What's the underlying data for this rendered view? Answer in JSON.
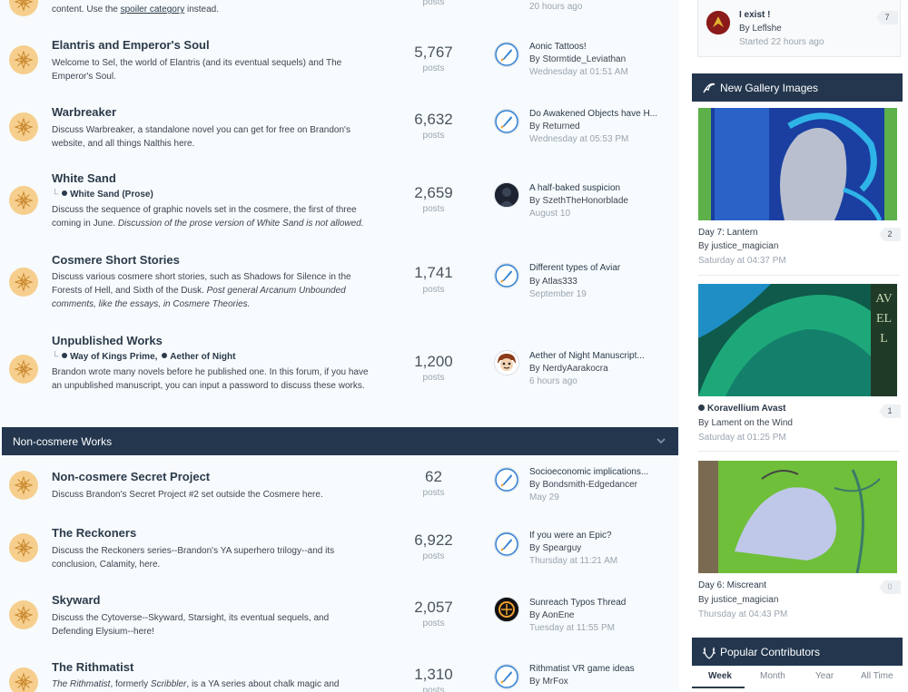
{
  "top_fragment": {
    "desc_prefix": "content. Use the ",
    "desc_link": "spoiler category",
    "desc_suffix": " instead.",
    "count_label": "posts",
    "last_time": "20 hours ago"
  },
  "forums": [
    {
      "title": "Elantris and Emperor's Soul",
      "description": "Welcome to Sel, the world of Elantris (and its eventual sequels) and The Emperor's Soul.",
      "count": "5,767",
      "count_label": "posts",
      "last_title": "Aonic Tattoos!",
      "last_by": "By Stormtide_Leviathan",
      "last_time": "Wednesday at 01:51 AM",
      "avatar": "quill-avatar"
    },
    {
      "title": "Warbreaker",
      "description": "Discuss Warbreaker, a standalone novel you can get for free on Brandon's website, and all things Nalthis here.",
      "count": "6,632",
      "count_label": "posts",
      "last_title": "Do Awakened Objects have H...",
      "last_by": "By Returned",
      "last_time": "Wednesday at 05:53 PM",
      "avatar": "quill-avatar"
    },
    {
      "title": "White Sand",
      "subforum": "White Sand (Prose)",
      "description": "Discuss the sequence of graphic novels set in the cosmere, the first of three coming in June.",
      "description_italic": "Discussion of the prose version of White Sand is not allowed.",
      "count": "2,659",
      "count_label": "posts",
      "last_title": "A half-baked suspicion",
      "last_by": "By SzethTheHonorblade",
      "last_time": "August 10",
      "avatar": "dark-figure-avatar"
    },
    {
      "title": "Cosmere Short Stories",
      "description": "Discuss various cosmere short stories, such as Shadows for Silence in the Forests of Hell, and Sixth of the Dusk.",
      "description_italic": "Post general Arcanum Unbounded comments, like the essays, in Cosmere Theories.",
      "count": "1,741",
      "count_label": "posts",
      "last_title": "Different types of Aviar",
      "last_by": "By Atlas333",
      "last_time": "September 19",
      "avatar": "quill-avatar"
    },
    {
      "title": "Unpublished Works",
      "subforum": "Way of Kings Prime,",
      "subforum2": "Aether of Night",
      "description": "Brandon wrote many novels before he published one. In this forum, if you have an unpublished manuscript, you can input a password to discuss these works.",
      "count": "1,200",
      "count_label": "posts",
      "last_title": "Aether of Night Manuscript...",
      "last_by": "By NerdyAarakocra",
      "last_time": "6 hours ago",
      "avatar": "cartoon-face-avatar"
    }
  ],
  "category": {
    "label": "Non-cosmere Works"
  },
  "forums2": [
    {
      "title": "Non-cosmere Secret Project",
      "description": "Discuss Brandon's Secret Project #2 set outside the Cosmere here.",
      "count": "62",
      "count_label": "posts",
      "last_title": "Socioeconomic implications...",
      "last_by": "By Bondsmith-Edgedancer",
      "last_time": "May 29",
      "avatar": "quill-avatar"
    },
    {
      "title": "The Reckoners",
      "description": "Discuss the Reckoners series--Brandon's YA superhero trilogy--and its conclusion, Calamity, here.",
      "count": "6,922",
      "count_label": "posts",
      "last_title": "If you were an Epic?",
      "last_by": "By Spearguy",
      "last_time": "Thursday at 11:21 AM",
      "avatar": "quill-avatar"
    },
    {
      "title": "Skyward",
      "description": "Discuss the Cytoverse--Skyward, Starsight, its eventual sequels, and Defending Elysium--here!",
      "count": "2,057",
      "count_label": "posts",
      "last_title": "Sunreach Typos Thread",
      "last_by": "By AonEne",
      "last_time": "Tuesday at 11:55 PM",
      "avatar": "aon-avatar"
    },
    {
      "title": "The Rithmatist",
      "description_italic_lead": "The Rithmatist",
      "description_mid": ", formerly ",
      "description_italic_mid": "Scribbler",
      "description_tail": ", is a YA series about chalk magic and",
      "count": "1,310",
      "count_label": "posts",
      "last_title": "Rithmatist VR game ideas",
      "last_by": "By MrFox",
      "avatar": "quill-avatar"
    }
  ],
  "sidebar": {
    "topic": {
      "title": "I exist !",
      "by": "By Leflshe",
      "time": "Started 22 hours ago",
      "replies": "7"
    },
    "gallery_header": "New Gallery Images",
    "gallery": [
      {
        "title": "Day 7: Lantern",
        "by": "By justice_magician",
        "time": "Saturday at 04:37 PM",
        "comments": "2"
      },
      {
        "title": "Koravellium Avast",
        "by": "By Lament on the Wind",
        "time": "Saturday at 01:25 PM",
        "comments": "1",
        "image_letters": "AVELL"
      },
      {
        "title": "Day 6: Miscreant",
        "by": "By justice_magician",
        "time": "Thursday at 04:43 PM",
        "comments": "0"
      }
    ],
    "contributors_header": "Popular Contributors",
    "tabs": [
      "Week",
      "Month",
      "Year",
      "All Time"
    ]
  },
  "colors": {
    "accent": "#23364e",
    "icon_bg": "#f6cf8f",
    "muted": "#9aa5b0"
  }
}
